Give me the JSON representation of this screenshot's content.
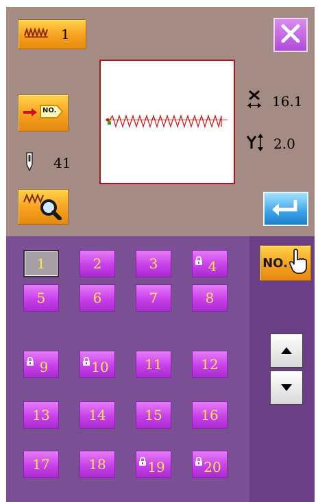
{
  "header": {
    "pattern_no": "1",
    "pattern_icon": "stitch-pattern-icon"
  },
  "close": {
    "icon": "close-icon"
  },
  "goto": {
    "label": "NO."
  },
  "needle": {
    "value": "41",
    "icon": "needle-icon"
  },
  "scale": {
    "x_value": "16.1",
    "y_value": "2.0",
    "x_icon": "x-scale-icon",
    "y_icon": "y-scale-icon"
  },
  "patterns": [
    {
      "num": "1",
      "locked": false,
      "selected": true
    },
    {
      "num": "2",
      "locked": false
    },
    {
      "num": "3",
      "locked": false
    },
    {
      "num": "4",
      "locked": true
    },
    {
      "num": "5",
      "locked": false
    },
    {
      "num": "6",
      "locked": false
    },
    {
      "num": "7",
      "locked": false
    },
    {
      "num": "8",
      "locked": false
    },
    {
      "num": "9",
      "locked": true
    },
    {
      "num": "10",
      "locked": true
    },
    {
      "num": "11",
      "locked": false
    },
    {
      "num": "12",
      "locked": false
    },
    {
      "num": "13",
      "locked": false
    },
    {
      "num": "14",
      "locked": false
    },
    {
      "num": "15",
      "locked": false
    },
    {
      "num": "16",
      "locked": false
    },
    {
      "num": "17",
      "locked": false
    },
    {
      "num": "18",
      "locked": false
    },
    {
      "num": "19",
      "locked": true
    },
    {
      "num": "20",
      "locked": true
    }
  ],
  "no_search": {
    "label": "NO."
  },
  "colors": {
    "top_panel": "#a48c84",
    "bottom_panel": "#7a4f94",
    "button_purple": "#c940ea",
    "button_orange": "#f7a11f",
    "number_yellow": "#ffe94a",
    "preview_border": "#b3141a"
  }
}
